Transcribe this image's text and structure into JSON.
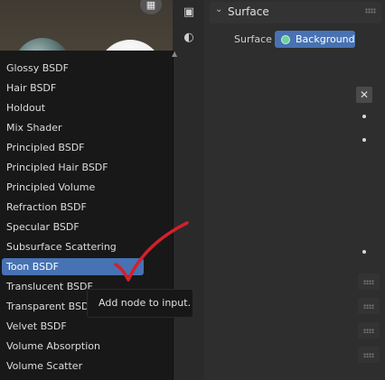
{
  "properties": {
    "panel_title": "Surface",
    "surface_label": "Surface",
    "surface_value": "Background"
  },
  "menu": {
    "items": [
      {
        "label": "Glossy BSDF"
      },
      {
        "label": "Hair BSDF"
      },
      {
        "label": "Holdout"
      },
      {
        "label": "Mix Shader"
      },
      {
        "label": "Principled BSDF"
      },
      {
        "label": "Principled Hair BSDF"
      },
      {
        "label": "Principled Volume"
      },
      {
        "label": "Refraction BSDF"
      },
      {
        "label": "Specular BSDF"
      },
      {
        "label": "Subsurface Scattering"
      },
      {
        "label": "Toon BSDF",
        "active": true
      },
      {
        "label": "Translucent BSDF"
      },
      {
        "label": "Transparent BSDF"
      },
      {
        "label": "Velvet BSDF"
      },
      {
        "label": "Volume Absorption"
      },
      {
        "label": "Volume Scatter"
      }
    ]
  },
  "tooltip": {
    "text": "Add node to input."
  },
  "close_glyph": "✕",
  "colors": {
    "accent": "#4772b3",
    "annotation": "#d4202a",
    "node_dot": "#6fd39a"
  },
  "icons": [
    "grid-icon",
    "image-icon",
    "shader-icon",
    "chevron-down-icon",
    "close-icon",
    "checkmark-annotation"
  ]
}
